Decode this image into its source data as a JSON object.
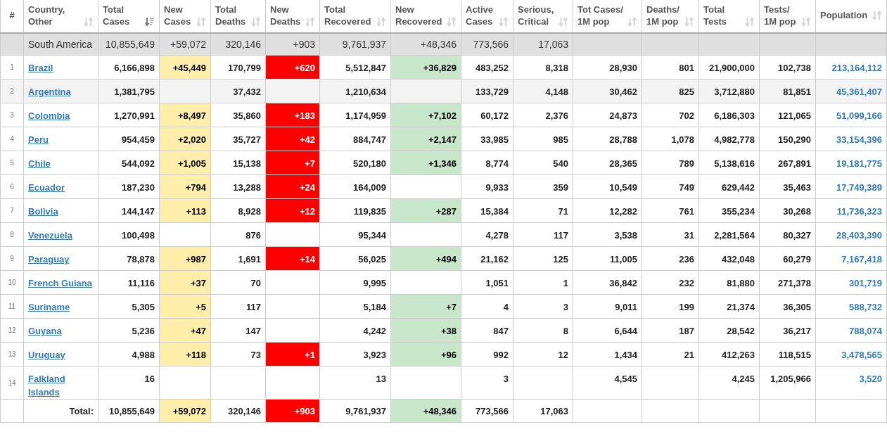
{
  "columns": [
    {
      "lines": [
        "#"
      ]
    },
    {
      "lines": [
        "Country,",
        "Other"
      ],
      "sorted": false
    },
    {
      "lines": [
        "Total",
        "Cases"
      ],
      "sorted": true
    },
    {
      "lines": [
        "New",
        "Cases"
      ],
      "sorted": false,
      "color": "#ffeeaa"
    },
    {
      "lines": [
        "Total",
        "Deaths"
      ],
      "sorted": false
    },
    {
      "lines": [
        "New",
        "Deaths"
      ],
      "sorted": false,
      "color": "#ff0000"
    },
    {
      "lines": [
        "Total",
        "Recovered"
      ],
      "sorted": false
    },
    {
      "lines": [
        "New",
        "Recovered"
      ],
      "sorted": false,
      "color": "#c8e6c9"
    },
    {
      "lines": [
        "Active",
        "Cases"
      ],
      "sorted": false
    },
    {
      "lines": [
        "Serious,",
        "Critical"
      ],
      "sorted": false
    },
    {
      "lines": [
        "Tot Cases/",
        "1M pop"
      ],
      "sorted": false
    },
    {
      "lines": [
        "Deaths/",
        "1M pop"
      ],
      "sorted": false
    },
    {
      "lines": [
        "Total",
        "Tests"
      ],
      "sorted": false
    },
    {
      "lines": [
        "Tests/",
        "1M pop"
      ],
      "sorted": false
    },
    {
      "lines": [
        "Population"
      ],
      "sorted": false
    }
  ],
  "continent": {
    "name": "South America",
    "total_cases": "10,855,649",
    "new_cases": "+59,072",
    "total_deaths": "320,146",
    "new_deaths": "+903",
    "total_recovered": "9,761,937",
    "new_recovered": "+48,346",
    "active_cases": "773,566",
    "serious_critical": "17,063"
  },
  "rows": [
    {
      "rank": "1",
      "country": "Brazil",
      "highlighted": false,
      "total_cases": "6,166,898",
      "new_cases": "+45,449",
      "total_deaths": "170,799",
      "new_deaths": "+620",
      "total_recovered": "5,512,847",
      "new_recovered": "+36,829",
      "active_cases": "483,252",
      "serious_critical": "8,318",
      "cases_per_1m": "28,930",
      "deaths_per_1m": "801",
      "total_tests": "21,900,000",
      "tests_per_1m": "102,738",
      "population": "213,164,112"
    },
    {
      "rank": "2",
      "country": "Argentina",
      "highlighted": true,
      "total_cases": "1,381,795",
      "total_deaths": "37,432",
      "total_recovered": "1,210,634",
      "active_cases": "133,729",
      "serious_critical": "4,148",
      "cases_per_1m": "30,462",
      "deaths_per_1m": "825",
      "total_tests": "3,712,880",
      "tests_per_1m": "81,851",
      "population": "45,361,407"
    },
    {
      "rank": "3",
      "country": "Colombia",
      "highlighted": false,
      "total_cases": "1,270,991",
      "new_cases": "+8,497",
      "total_deaths": "35,860",
      "new_deaths": "+183",
      "total_recovered": "1,174,959",
      "new_recovered": "+7,102",
      "active_cases": "60,172",
      "serious_critical": "2,376",
      "cases_per_1m": "24,873",
      "deaths_per_1m": "702",
      "total_tests": "6,186,303",
      "tests_per_1m": "121,065",
      "population": "51,099,166"
    },
    {
      "rank": "4",
      "country": "Peru",
      "highlighted": false,
      "total_cases": "954,459",
      "new_cases": "+2,020",
      "total_deaths": "35,727",
      "new_deaths": "+42",
      "total_recovered": "884,747",
      "new_recovered": "+2,147",
      "active_cases": "33,985",
      "serious_critical": "985",
      "cases_per_1m": "28,788",
      "deaths_per_1m": "1,078",
      "total_tests": "4,982,778",
      "tests_per_1m": "150,290",
      "population": "33,154,396"
    },
    {
      "rank": "5",
      "country": "Chile",
      "highlighted": false,
      "total_cases": "544,092",
      "new_cases": "+1,005",
      "total_deaths": "15,138",
      "new_deaths": "+7",
      "total_recovered": "520,180",
      "new_recovered": "+1,346",
      "active_cases": "8,774",
      "serious_critical": "540",
      "cases_per_1m": "28,365",
      "deaths_per_1m": "789",
      "total_tests": "5,138,616",
      "tests_per_1m": "267,891",
      "population": "19,181,775"
    },
    {
      "rank": "6",
      "country": "Ecuador",
      "highlighted": false,
      "total_cases": "187,230",
      "new_cases": "+794",
      "total_deaths": "13,288",
      "new_deaths": "+24",
      "total_recovered": "164,009",
      "active_cases": "9,933",
      "serious_critical": "359",
      "cases_per_1m": "10,549",
      "deaths_per_1m": "749",
      "total_tests": "629,442",
      "tests_per_1m": "35,463",
      "population": "17,749,389"
    },
    {
      "rank": "7",
      "country": "Bolivia",
      "highlighted": false,
      "total_cases": "144,147",
      "new_cases": "+113",
      "total_deaths": "8,928",
      "new_deaths": "+12",
      "total_recovered": "119,835",
      "new_recovered": "+287",
      "active_cases": "15,384",
      "serious_critical": "71",
      "cases_per_1m": "12,282",
      "deaths_per_1m": "761",
      "total_tests": "355,234",
      "tests_per_1m": "30,268",
      "population": "11,736,323"
    },
    {
      "rank": "8",
      "country": "Venezuela",
      "highlighted": false,
      "total_cases": "100,498",
      "total_deaths": "876",
      "total_recovered": "95,344",
      "active_cases": "4,278",
      "serious_critical": "117",
      "cases_per_1m": "3,538",
      "deaths_per_1m": "31",
      "total_tests": "2,281,564",
      "tests_per_1m": "80,327",
      "population": "28,403,390"
    },
    {
      "rank": "9",
      "country": "Paraguay",
      "highlighted": false,
      "total_cases": "78,878",
      "new_cases": "+987",
      "total_deaths": "1,691",
      "new_deaths": "+14",
      "total_recovered": "56,025",
      "new_recovered": "+494",
      "active_cases": "21,162",
      "serious_critical": "125",
      "cases_per_1m": "11,005",
      "deaths_per_1m": "236",
      "total_tests": "432,048",
      "tests_per_1m": "60,279",
      "population": "7,167,418"
    },
    {
      "rank": "10",
      "country": "French Guiana",
      "highlighted": false,
      "total_cases": "11,116",
      "new_cases": "+37",
      "total_deaths": "70",
      "total_recovered": "9,995",
      "active_cases": "1,051",
      "serious_critical": "1",
      "cases_per_1m": "36,842",
      "deaths_per_1m": "232",
      "total_tests": "81,880",
      "tests_per_1m": "271,378",
      "population": "301,719"
    },
    {
      "rank": "11",
      "country": "Suriname",
      "highlighted": false,
      "total_cases": "5,305",
      "new_cases": "+5",
      "total_deaths": "117",
      "total_recovered": "5,184",
      "new_recovered": "+7",
      "active_cases": "4",
      "serious_critical": "3",
      "cases_per_1m": "9,011",
      "deaths_per_1m": "199",
      "total_tests": "21,374",
      "tests_per_1m": "36,305",
      "population": "588,732"
    },
    {
      "rank": "12",
      "country": "Guyana",
      "highlighted": false,
      "total_cases": "5,236",
      "new_cases": "+47",
      "total_deaths": "147",
      "total_recovered": "4,242",
      "new_recovered": "+38",
      "active_cases": "847",
      "serious_critical": "8",
      "cases_per_1m": "6,644",
      "deaths_per_1m": "187",
      "total_tests": "28,542",
      "tests_per_1m": "36,217",
      "population": "788,074"
    },
    {
      "rank": "13",
      "country": "Uruguay",
      "highlighted": false,
      "total_cases": "4,988",
      "new_cases": "+118",
      "total_deaths": "73",
      "new_deaths": "+1",
      "total_recovered": "3,923",
      "new_recovered": "+96",
      "active_cases": "992",
      "serious_critical": "12",
      "cases_per_1m": "1,434",
      "deaths_per_1m": "21",
      "total_tests": "412,263",
      "tests_per_1m": "118,515",
      "population": "3,478,565"
    },
    {
      "rank": "14",
      "country": "Falkland Islands",
      "highlighted": false,
      "total_cases": "16",
      "total_recovered": "13",
      "active_cases": "3",
      "cases_per_1m": "4,545",
      "total_tests": "4,245",
      "tests_per_1m": "1,205,966",
      "population": "3,520"
    }
  ],
  "total": {
    "label": "Total:",
    "total_cases": "10,855,649",
    "new_cases": "+59,072",
    "total_deaths": "320,146",
    "new_deaths": "+903",
    "total_recovered": "9,761,937",
    "new_recovered": "+48,346",
    "active_cases": "773,566",
    "serious_critical": "17,063"
  }
}
